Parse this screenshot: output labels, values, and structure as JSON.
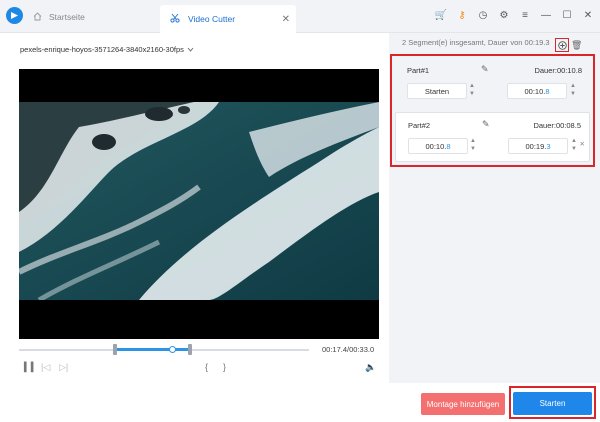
{
  "tabs": [
    {
      "label": "Startseite"
    },
    {
      "label": "Video Cutter"
    }
  ],
  "file": {
    "name": "pexels-enrique-hoyos-3571264-3840x2160-30fps"
  },
  "player": {
    "time": "00:17.4/00:33.0",
    "progress_fraction": 0.53,
    "selection_start_fraction": 0.33,
    "selection_end_fraction": 0.59
  },
  "segments": {
    "info": "2 Segment(e) insgesamt, Dauer von 00:19.3",
    "items": [
      {
        "title": "Part#1",
        "duration": "Dauer:00:10.8",
        "start": "Starten",
        "end_main": "00:10.",
        "end_digit": "8"
      },
      {
        "title": "Part#2",
        "duration": "Dauer:00:08.5",
        "start_main": "00:10.",
        "start_digit": "8",
        "end_main": "00:19.",
        "end_digit": "3"
      }
    ]
  },
  "buttons": {
    "montage": "Montage hinzufügen",
    "start": "Starten"
  },
  "icons": [
    "app-logo-icon",
    "home-icon",
    "scissors-icon",
    "close-icon",
    "cart-icon",
    "key-icon",
    "clock-icon",
    "gear-icon",
    "menu-icon",
    "minimize-icon",
    "maximize-icon",
    "window-close-icon",
    "chevron-down-icon",
    "play-icon",
    "prev-frame-icon",
    "next-frame-icon",
    "bracket-left-icon",
    "bracket-right-icon",
    "volume-icon",
    "add-segment-icon",
    "trash-icon",
    "edit-icon"
  ],
  "colors": {
    "accent": "#1f87ea",
    "highlight": "#d9262b",
    "montage": "#f47070"
  }
}
